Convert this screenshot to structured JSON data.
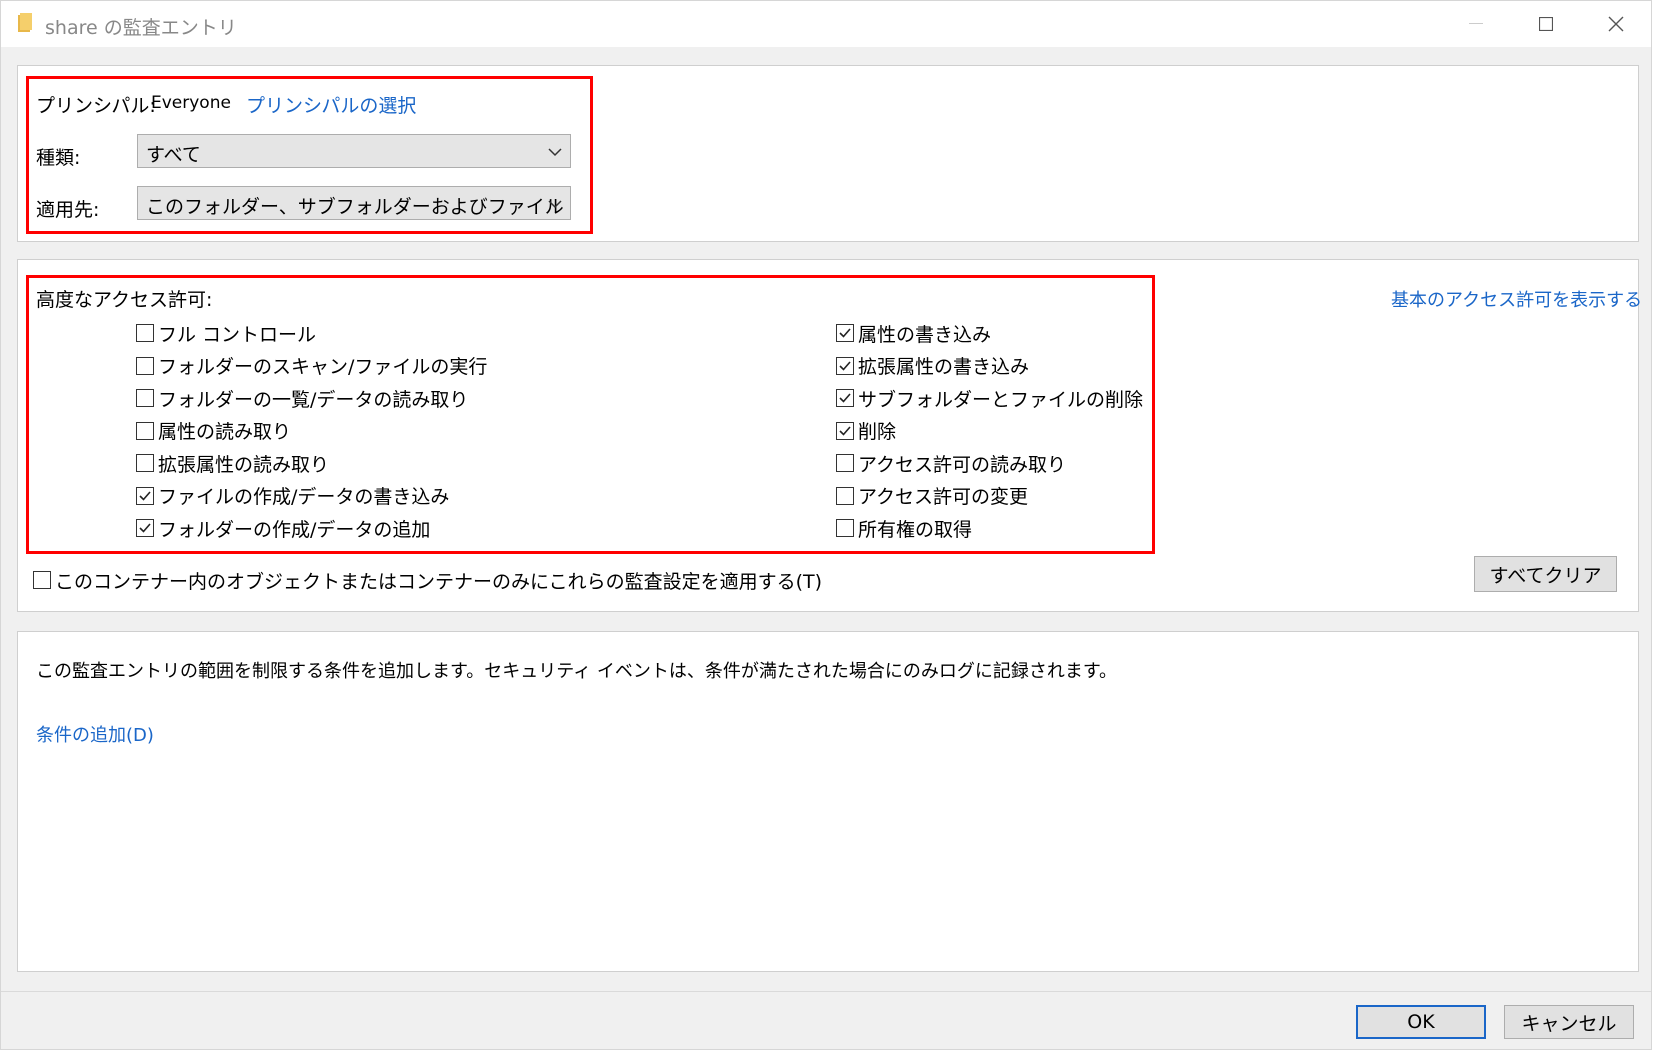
{
  "window": {
    "title": "share の監査エントリ",
    "minimize_label": "—",
    "maximize_label": "☐",
    "close_label": "✕"
  },
  "principal": {
    "label": "プリンシパル:",
    "value": "Everyone",
    "select_link": "プリンシパルの選択"
  },
  "type": {
    "label": "種類:",
    "value": "すべて"
  },
  "apply_to": {
    "label": "適用先:",
    "value": "このフォルダー、サブフォルダーおよびファイル"
  },
  "permissions": {
    "heading": "高度なアクセス許可:",
    "show_basic_link": "基本のアクセス許可を表示する",
    "left": [
      {
        "label": "フル コントロール",
        "checked": false
      },
      {
        "label": "フォルダーのスキャン/ファイルの実行",
        "checked": false
      },
      {
        "label": "フォルダーの一覧/データの読み取り",
        "checked": false
      },
      {
        "label": "属性の読み取り",
        "checked": false
      },
      {
        "label": "拡張属性の読み取り",
        "checked": false
      },
      {
        "label": "ファイルの作成/データの書き込み",
        "checked": true
      },
      {
        "label": "フォルダーの作成/データの追加",
        "checked": true
      }
    ],
    "right": [
      {
        "label": "属性の書き込み",
        "checked": true
      },
      {
        "label": "拡張属性の書き込み",
        "checked": true
      },
      {
        "label": "サブフォルダーとファイルの削除",
        "checked": true
      },
      {
        "label": "削除",
        "checked": true
      },
      {
        "label": "アクセス許可の読み取り",
        "checked": false
      },
      {
        "label": "アクセス許可の変更",
        "checked": false
      },
      {
        "label": "所有権の取得",
        "checked": false
      }
    ],
    "apply_only_label": "このコンテナー内のオブジェクトまたはコンテナーのみにこれらの監査設定を適用する(T)",
    "apply_only_checked": false,
    "clear_all_label": "すべてクリア"
  },
  "conditions": {
    "description": "この監査エントリの範囲を制限する条件を追加します。セキュリティ イベントは、条件が満たされた場合にのみログに記録されます。",
    "add_link": "条件の追加(D)"
  },
  "footer": {
    "ok_label": "OK",
    "cancel_label": "キャンセル"
  },
  "colors": {
    "link": "#1a66c8",
    "highlight_box": "#ff0000",
    "title_text": "#888888"
  }
}
